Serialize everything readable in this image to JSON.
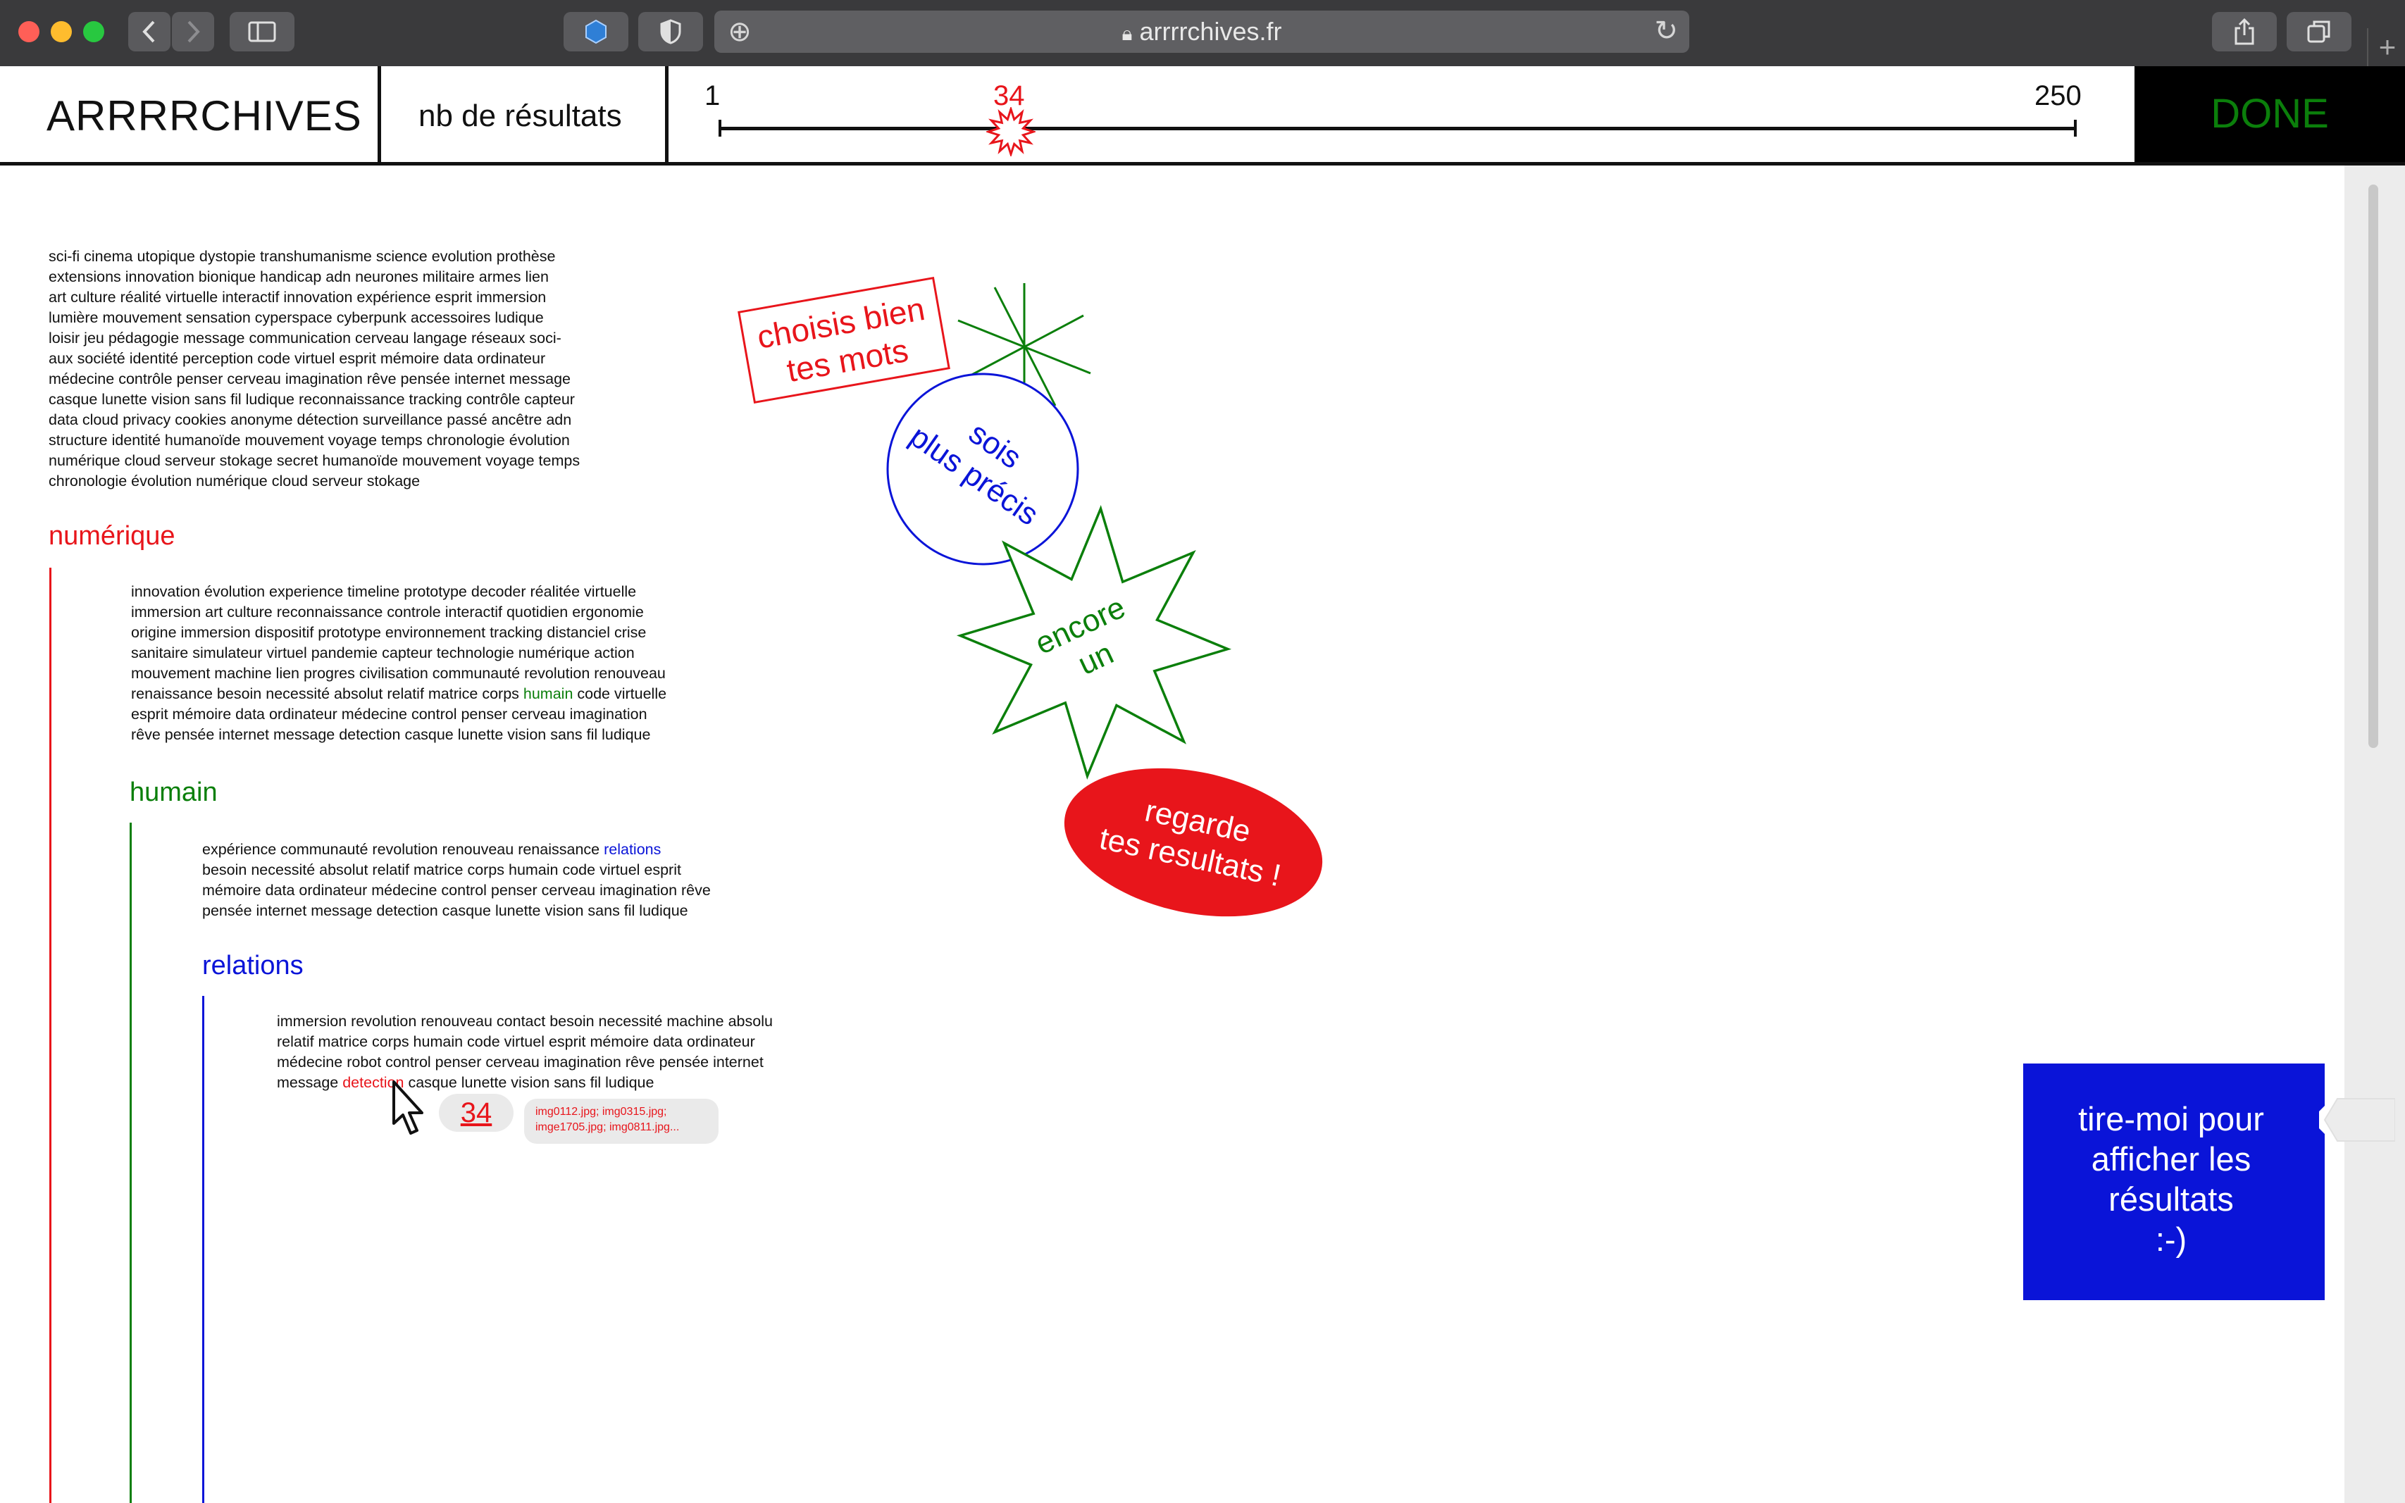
{
  "browser": {
    "url": "arrrrchives.fr",
    "back_icon": "chevron-left-icon",
    "forward_icon": "chevron-right-icon"
  },
  "header": {
    "logo": "ARRRRCHIVES",
    "results_label": "nb de résultats",
    "slider": {
      "min": "1",
      "max": "250",
      "value": "34"
    },
    "done_label": "DONE"
  },
  "intro_words": "sci-fi cinema utopique dystopie transhumanisme science evolution prothèse\nextensions innovation bionique handicap adn neurones militaire armes lien\nart culture réalité virtuelle interactif innovation expérience esprit immersion\nlumière mouvement sensation cyperspace cyberpunk accessoires ludique\nloisir jeu pédagogie message communication cerveau langage réseaux soci-\naux société identité perception code virtuel esprit mémoire data ordinateur\nmédecine contrôle penser cerveau imagination rêve pensée internet message\ncasque lunette vision sans fil ludique reconnaissance tracking contrôle capteur\ndata cloud privacy cookies anonyme détection surveillance passé ancêtre adn\nstructure identité humanoïde mouvement voyage temps chronologie évolution\nnumérique cloud serveur stokage secret humanoïde mouvement voyage temps\nchronologie évolution numérique cloud serveur stokage",
  "level1": {
    "title": "numérique",
    "words_before": "innovation évolution experience timeline prototype decoder réalitée virtuelle\nimmersion art culture reconnaissance controle interactif quotidien ergonomie\norigine immersion dispositif prototype environnement tracking distanciel crise\nsanitaire simulateur virtuel pandemie capteur technologie numérique  action\nmouvement machine lien progres civilisation communauté revolution renouveau\nrenaissance besoin necessité absolut relatif matrice corps ",
    "highlight": "humain",
    "words_after": " code virtuelle\nesprit mémoire data ordinateur médecine control penser cerveau imagination\nrêve pensée internet message detection casque lunette vision sans fil ludique"
  },
  "level2": {
    "title": "humain",
    "words_before": "expérience communauté revolution renouveau renaissance ",
    "highlight": "relations",
    "words_after": "\nbesoin necessité absolut relatif matrice corps humain code virtuel esprit\nmémoire data ordinateur médecine control penser cerveau imagination rêve\npensée internet message detection casque lunette vision sans fil ludique"
  },
  "level3": {
    "title": "relations",
    "words_before": "immersion revolution renouveau contact besoin necessité machine absolu\nrelatif matrice corps humain code virtuel esprit mémoire data ordinateur\nmédecine robot control penser cerveau imagination rêve pensée internet\nmessage ",
    "highlight": "detection",
    "words_after": " casque lunette vision sans fil ludique",
    "result_count": "34",
    "images_line1": "img0112.jpg; img0315.jpg;",
    "images_line2": "imge1705.jpg; img0811.jpg..."
  },
  "stickers": {
    "choose_l1": "choisis bien",
    "choose_l2": "tes mots",
    "precise_l1": "sois",
    "precise_l2": "plus précis",
    "again_l1": "encore",
    "again_l2": "un",
    "look_l1": "regarde",
    "look_l2": "tes resultats !"
  },
  "pull_tab": {
    "text": "tire-moi pour\nafficher les\nrésultats\n:-)"
  },
  "colors": {
    "red": "#e8151b",
    "green": "#0b7f0b",
    "blue": "#0a14d8",
    "black": "#111111"
  }
}
